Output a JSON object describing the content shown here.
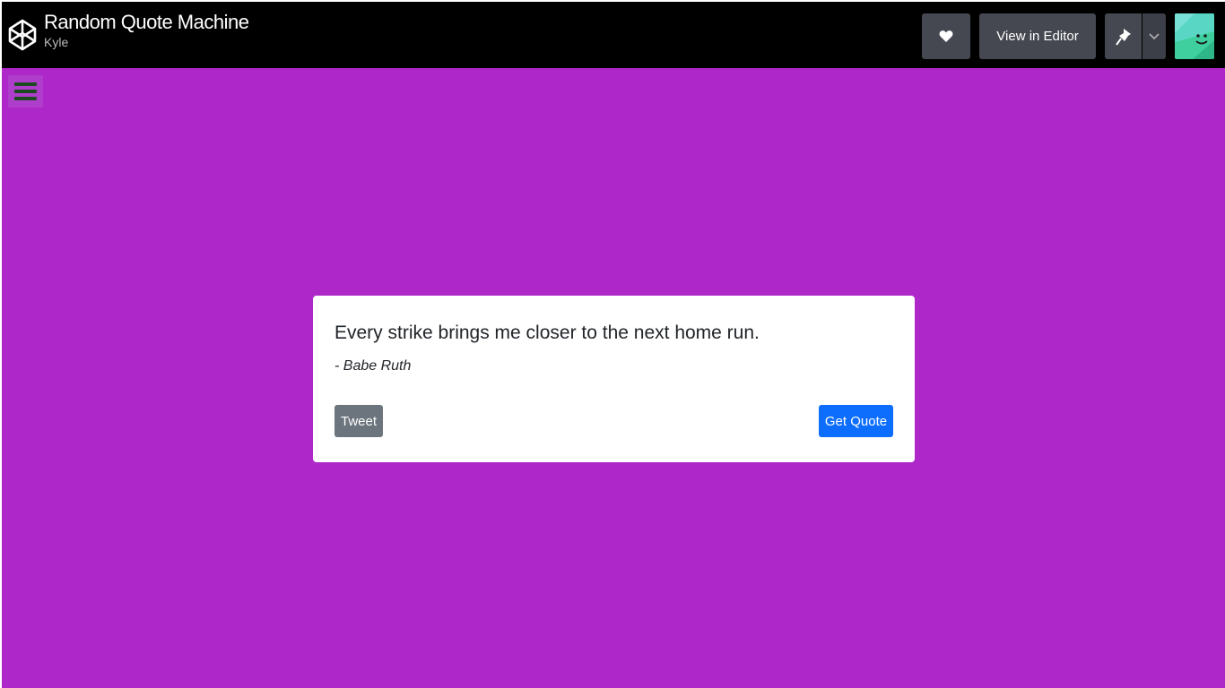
{
  "header": {
    "pen_title": "Random Quote Machine",
    "author": "Kyle",
    "logo_icon": "codepen-logo-icon",
    "heart_icon": "heart-icon",
    "view_in_editor_label": "View in Editor",
    "pin_icon": "pin-icon",
    "chevron_icon": "chevron-down-icon",
    "avatar_icon": "user-avatar"
  },
  "page": {
    "background_color": "#ad27c9",
    "menu_icon": "hamburger-menu-icon"
  },
  "quote_card": {
    "quote": "Every strike brings me closer to the next home run.",
    "author": "- Babe Ruth",
    "tweet_label": "Tweet",
    "get_quote_label": "Get Quote",
    "tweet_color": "#6c757d",
    "get_quote_color": "#0d6efd"
  }
}
